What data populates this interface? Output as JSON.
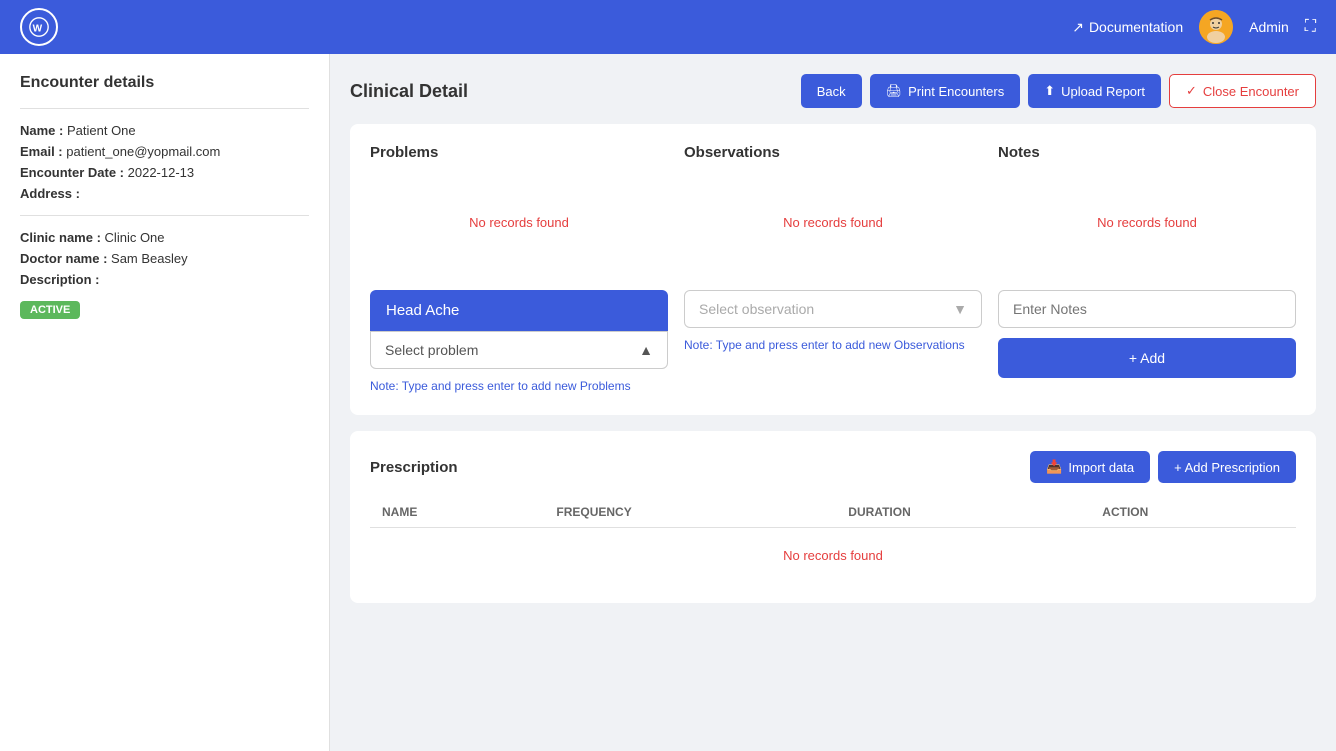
{
  "topnav": {
    "logo_text": "W",
    "doc_link_label": "Documentation",
    "admin_label": "Admin"
  },
  "sidebar": {
    "title": "Encounter details",
    "name_label": "Name :",
    "name_value": "Patient One",
    "email_label": "Email :",
    "email_value": "patient_one@yopmail.com",
    "encounter_date_label": "Encounter Date :",
    "encounter_date_value": "2022-12-13",
    "address_label": "Address :",
    "address_value": "",
    "clinic_label": "Clinic name :",
    "clinic_value": "Clinic One",
    "doctor_label": "Doctor name :",
    "doctor_value": "Sam Beasley",
    "description_label": "Description :",
    "description_value": "",
    "status_badge": "ACTIVE"
  },
  "content": {
    "title": "Clinical Detail",
    "buttons": {
      "back": "Back",
      "print": "Print Encounters",
      "upload": "Upload Report",
      "close": "Close Encounter"
    }
  },
  "problems": {
    "section_title": "Problems",
    "no_records": "No records found",
    "tag_label": "Head Ache",
    "select_placeholder": "Select problem",
    "hint": "Note: Type and press enter to add new Problems"
  },
  "observations": {
    "section_title": "Observations",
    "no_records": "No records found",
    "select_placeholder": "Select observation",
    "hint": "Note: Type and press enter to add new Observations"
  },
  "notes": {
    "section_title": "Notes",
    "no_records": "No records found",
    "input_placeholder": "Enter Notes",
    "add_button": "+ Add"
  },
  "prescription": {
    "section_title": "Prescription",
    "import_button": "Import data",
    "add_button": "+ Add Prescription",
    "columns": {
      "name": "NAME",
      "frequency": "FREQUENCY",
      "duration": "DURATION",
      "action": "ACTION"
    },
    "no_records": "No records found"
  }
}
